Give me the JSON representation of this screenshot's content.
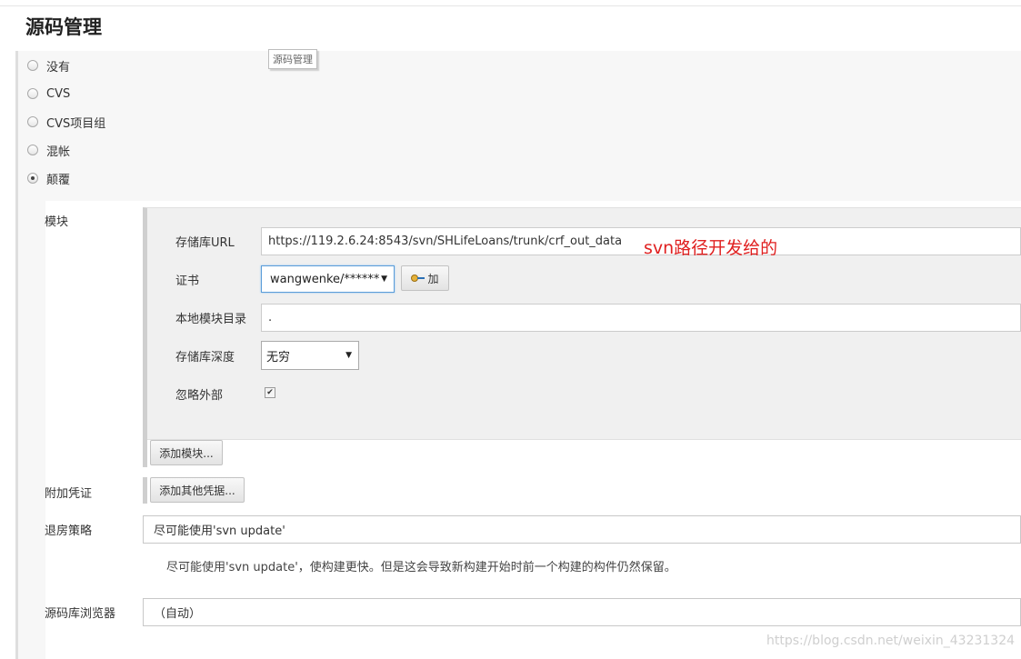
{
  "section": {
    "title": "源码管理",
    "tooltip": "源码管理"
  },
  "scm_options": [
    {
      "label": "没有",
      "checked": false
    },
    {
      "label": "CVS",
      "checked": false
    },
    {
      "label": "CVS项目组",
      "checked": false
    },
    {
      "label": "混帐",
      "checked": false
    },
    {
      "label": "颠覆",
      "checked": true
    }
  ],
  "modules": {
    "label": "模块",
    "repository_url_label": "存储库URL",
    "repository_url_value": "https://119.2.6.24:8543/svn/SHLifeLoans/trunk/crf_out_data",
    "annotation": "svn路径开发给的",
    "credentials_label": "证书",
    "credentials_value": "wangwenke/******",
    "add_credentials_button": "加",
    "local_dir_label": "本地模块目录",
    "local_dir_value": ".",
    "depth_label": "存储库深度",
    "depth_value": "无穷",
    "ignore_externals_label": "忽略外部",
    "ignore_externals_checked": true,
    "add_module_button": "添加模块..."
  },
  "additional_credentials": {
    "label": "附加凭证",
    "button": "添加其他凭据..."
  },
  "checkout_strategy": {
    "label": "退房策略",
    "value": "尽可能使用'svn update'",
    "help": "尽可能使用'svn update'，使构建更快。但是这会导致新构建开始时前一个构建的构件仍然保留。"
  },
  "repository_browser": {
    "label": "源码库浏览器",
    "value": "（自动）"
  },
  "watermark": "https://blog.csdn.net/weixin_43231324",
  "colors": {
    "annotation": "#e02020",
    "focus_border": "#5b9dd9"
  }
}
